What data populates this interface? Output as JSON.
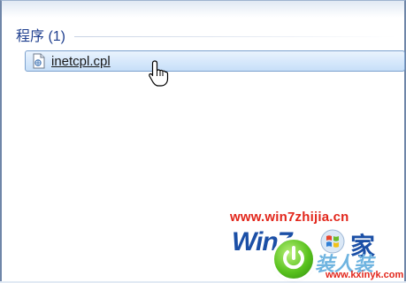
{
  "search_results": {
    "group_title": "程序 (1)",
    "items": [
      {
        "label": "inetcpl.cpl",
        "icon": "control-panel-file-icon",
        "selected": true
      }
    ]
  },
  "watermark": {
    "url_top": "www.win7zhijia.cn",
    "brand_text": "Win7",
    "brand_suffix": "家",
    "cn_brand": "装人装",
    "url_bottom": "www.kxinyk.com",
    "colors": {
      "red": "#e2261b",
      "blue": "#1b4fa6",
      "green": "#59c21e"
    }
  }
}
